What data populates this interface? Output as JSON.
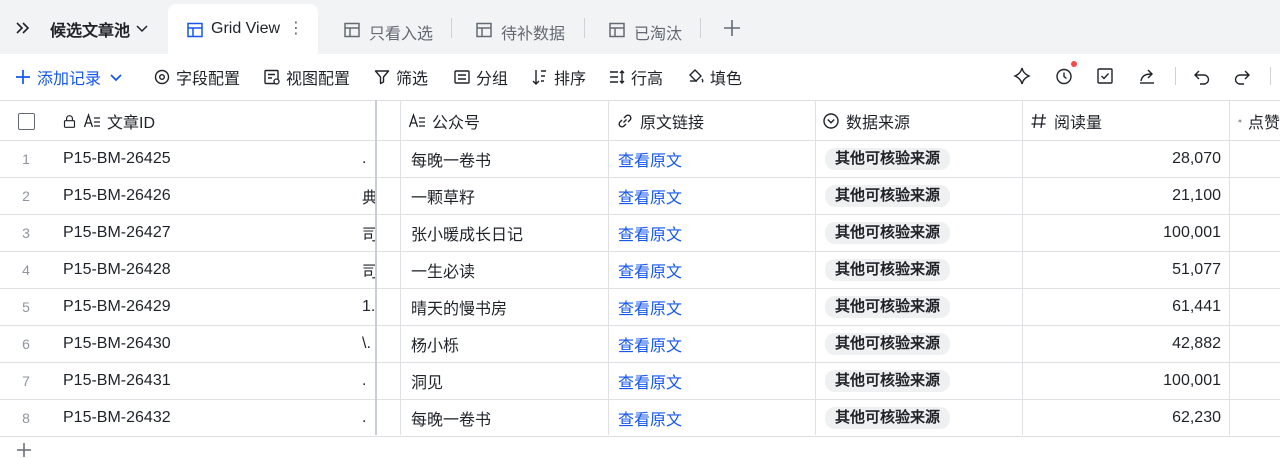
{
  "tabbar": {
    "title": "候选文章池",
    "tabs": [
      {
        "label": "Grid View",
        "active": true
      },
      {
        "label": "只看入选"
      },
      {
        "label": "待补数据"
      },
      {
        "label": "已淘汰"
      }
    ],
    "more_glyph": "⋮"
  },
  "toolbar": {
    "add_record": "添加记录",
    "field_config": "字段配置",
    "view_config": "视图配置",
    "filter": "筛选",
    "group": "分组",
    "sort": "排序",
    "row_height": "行高",
    "fill_color": "填色"
  },
  "columns": {
    "id": "文章ID",
    "account": "公众号",
    "link": "原文链接",
    "source": "数据来源",
    "reads": "阅读量",
    "likes": "点赞"
  },
  "rows": [
    {
      "num": "1",
      "id": "P15-BM-26425",
      "trunc": ".",
      "account": "每晚一卷书",
      "link": "查看原文",
      "source": "其他可核验来源",
      "reads": "28,070"
    },
    {
      "num": "2",
      "id": "P15-BM-26426",
      "trunc": "典.",
      "account": "一颗草籽",
      "link": "查看原文",
      "source": "其他可核验来源",
      "reads": "21,100"
    },
    {
      "num": "3",
      "id": "P15-BM-26427",
      "trunc": "司.",
      "account": "张小暖成长日记",
      "link": "查看原文",
      "source": "其他可核验来源",
      "reads": "100,001"
    },
    {
      "num": "4",
      "id": "P15-BM-26428",
      "trunc": "司.",
      "account": "一生必读",
      "link": "查看原文",
      "source": "其他可核验来源",
      "reads": "51,077"
    },
    {
      "num": "5",
      "id": "P15-BM-26429",
      "trunc": "1.",
      "account": "晴天的慢书房",
      "link": "查看原文",
      "source": "其他可核验来源",
      "reads": "61,441"
    },
    {
      "num": "6",
      "id": "P15-BM-26430",
      "trunc": "\\.",
      "account": "杨小栎",
      "link": "查看原文",
      "source": "其他可核验来源",
      "reads": "42,882"
    },
    {
      "num": "7",
      "id": "P15-BM-26431",
      "trunc": ".",
      "account": "洞见",
      "link": "查看原文",
      "source": "其他可核验来源",
      "reads": "100,001"
    },
    {
      "num": "8",
      "id": "P15-BM-26432",
      "trunc": ".",
      "account": "每晚一卷书",
      "link": "查看原文",
      "source": "其他可核验来源",
      "reads": "62,230"
    }
  ],
  "colors": {
    "accent": "#1456f0",
    "tag_bg": "#eff0f1",
    "notify": "#f54a45"
  }
}
